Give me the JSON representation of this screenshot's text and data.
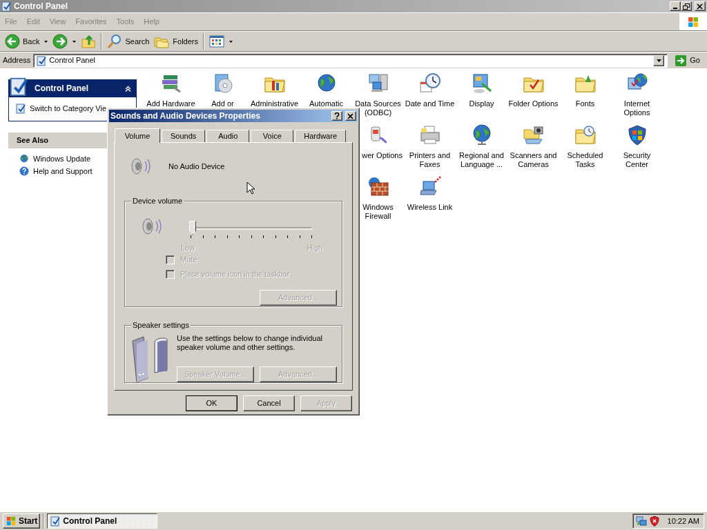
{
  "explorer": {
    "title": "Control Panel",
    "menu": [
      "File",
      "Edit",
      "View",
      "Favorites",
      "Tools",
      "Help"
    ],
    "toolbar": [
      {
        "kind": "back",
        "label": "Back",
        "dropdown": true
      },
      {
        "kind": "forward",
        "dropdown": true
      },
      {
        "kind": "up",
        "dropdown": false
      },
      {
        "kind": "search",
        "label": "Search",
        "dropdown": false
      },
      {
        "kind": "folders",
        "label": "Folders",
        "dropdown": false
      },
      {
        "kind": "views",
        "dropdown": true
      }
    ],
    "address_bar": {
      "label": "Address",
      "value": "Control Panel",
      "go_label": "Go"
    }
  },
  "task_pane": {
    "title": "Control Panel",
    "links": [
      "Switch to Category Vie"
    ],
    "see_also": {
      "title": "See Also",
      "links": [
        {
          "kind": "update",
          "label": "Windows Update"
        },
        {
          "kind": "help",
          "label": "Help and Support"
        }
      ]
    }
  },
  "applets": {
    "rows": [
      [
        {
          "kind": "hardware",
          "label": "Add Hardware"
        },
        {
          "kind": "programs",
          "label": "Add or"
        },
        {
          "kind": "tools",
          "label": "Administrative"
        },
        {
          "kind": "update",
          "label": "Automatic"
        },
        {
          "kind": "database",
          "label": "Data Sources (ODBC)"
        },
        {
          "kind": "clock",
          "label": "Date and Time"
        },
        {
          "kind": "display",
          "label": "Display"
        },
        {
          "kind": "folder",
          "label": "Folder Options"
        },
        {
          "kind": "fonts",
          "label": "Fonts"
        },
        {
          "kind": "internet",
          "label": "Internet Options"
        }
      ],
      [
        "",
        "",
        "",
        "",
        {
          "kind": "power",
          "label": "wer Options",
          "cut_left": true
        },
        {
          "kind": "printer",
          "label": "Printers and Faxes"
        },
        {
          "kind": "regional",
          "label": "Regional and Language ..."
        },
        {
          "kind": "scanner",
          "label": "Scanners and Cameras"
        },
        {
          "kind": "tasks",
          "label": "Scheduled Tasks"
        },
        {
          "kind": "security",
          "label": "Security Center"
        }
      ],
      [
        "",
        "",
        "",
        "",
        {
          "kind": "firewall",
          "label": "Windows Firewall"
        },
        {
          "kind": "wireless",
          "label": "Wireless Link"
        }
      ]
    ]
  },
  "dialog": {
    "title": "Sounds and Audio Devices Properties",
    "tabs": [
      {
        "label": "Volume",
        "selected": true
      },
      {
        "label": "Sounds",
        "selected": false
      },
      {
        "label": "Audio",
        "selected": false
      },
      {
        "label": "Voice",
        "selected": false
      },
      {
        "label": "Hardware",
        "selected": false
      }
    ],
    "device_name": "No Audio Device",
    "device_volume": {
      "title": "Device volume",
      "level": 0,
      "low_label": "Low",
      "high_label": "High",
      "disabled": true,
      "checkboxes": [
        {
          "label": "Mute",
          "checked": false,
          "disabled": true
        },
        {
          "label": "Place volume icon in the taskbar",
          "checked": false,
          "disabled": true
        }
      ],
      "advanced": {
        "label": "Advanced...",
        "disabled": true
      }
    },
    "speaker_settings": {
      "title": "Speaker settings",
      "text": "Use the settings below to change individual speaker volume and other settings.",
      "buttons": [
        {
          "label": "Speaker Volume...",
          "disabled": true
        },
        {
          "label": "Advanced...",
          "disabled": true
        }
      ]
    },
    "buttons": [
      {
        "label": "OK",
        "disabled": false,
        "default": true
      },
      {
        "label": "Cancel",
        "disabled": false,
        "default": false
      },
      {
        "label": "Apply",
        "disabled": true,
        "default": false
      }
    ]
  },
  "taskbar": {
    "start": "Start",
    "tasks": [
      {
        "label": "Control Panel",
        "selected": true
      }
    ],
    "clock": "10:22 AM"
  }
}
